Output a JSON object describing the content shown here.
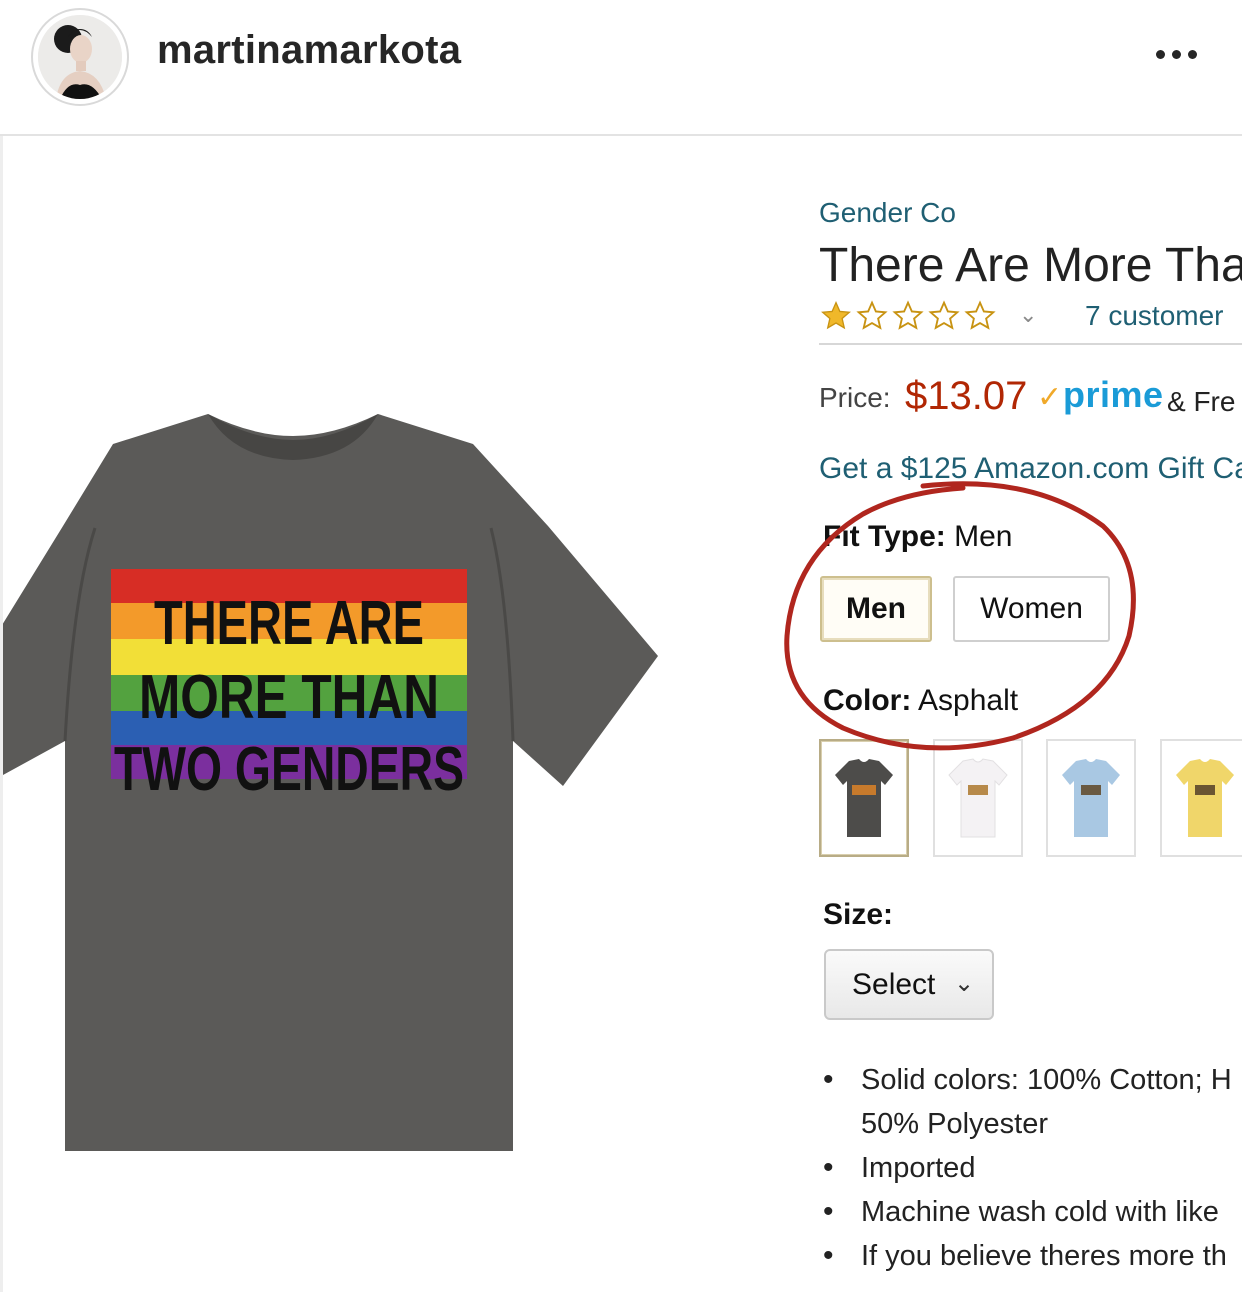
{
  "header": {
    "username": "martinamarkota"
  },
  "product": {
    "brand": "Gender Co",
    "title": "There Are More Tha",
    "reviews": "7 customer",
    "price_label": "Price:",
    "price": "$13.07",
    "prime_check": "✓",
    "prime": "prime",
    "free": "& Fre",
    "gift": "Get a $125 Amazon.com Gift Ca",
    "fit_type_label": "Fit Type:",
    "fit_type_value": "Men",
    "fit_options": [
      "Men",
      "Women"
    ],
    "color_label": "Color:",
    "color_value": "Asphalt",
    "size_label": "Size:",
    "size_select": "Select",
    "bullets": [
      "Solid colors: 100% Cotton; H",
      "50% Polyester",
      "Imported",
      "Machine wash cold with like",
      "If you believe theres more th"
    ]
  },
  "tshirt_print": [
    "THERE ARE",
    "MORE THAN",
    "TWO GENDERS"
  ],
  "rating": {
    "stars": 1,
    "max": 5
  },
  "colors": {
    "price": "#b12704",
    "link": "#1f5f73",
    "prime": "#1a9bd7",
    "shirt": "#5b5a58",
    "annotation_circle": "#b0261e"
  }
}
